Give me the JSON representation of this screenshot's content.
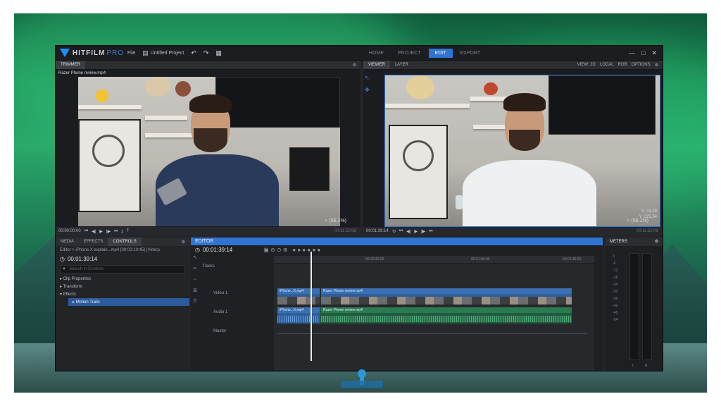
{
  "app": {
    "logo": "HITFILM",
    "logo_suffix": "PRO",
    "menu_file": "File",
    "project_name": "Untitled Project",
    "tabs": [
      "HOME",
      "PROJECT",
      "EDIT",
      "EXPORT"
    ],
    "active_tab": "EDIT"
  },
  "trimmer": {
    "tab": "TRIMMER",
    "clip_name": "Razer Phone review.mp4",
    "timecode": "00:00:00:00",
    "zoom": "(56.1%)",
    "end_timecode": "00:11:52:08"
  },
  "viewer": {
    "tabs": [
      "VIEWER",
      "LAYER"
    ],
    "view_mode": "VIEW: 2D",
    "local": "LOCAL",
    "rgb": "RGB",
    "options": "OPTIONS",
    "timecode": "00:01:39:14",
    "zoom": "(56.1%)",
    "coord_x": "X: 41.28",
    "coord_y": "Y: 225.54",
    "end_timecode": "00:11:52:08"
  },
  "controls": {
    "tabs": [
      "MEDIA",
      "EFFECTS",
      "CONTROLS"
    ],
    "editor_info": "Editor > iPhone X explain...mp4 [00:02:10:45] (Video)",
    "timecode": "00:01:39:14",
    "search_placeholder": "Search in Controls",
    "tree": [
      "Clip Properties",
      "Transform",
      "Effects"
    ],
    "selected_effect": "Motion Trails"
  },
  "editor": {
    "tab": "EDITOR",
    "timecode": "00:01:39:14",
    "tracks_label": "Tracks",
    "video_track": "Video 1",
    "audio_track": "Audio 1",
    "master": "Master",
    "clip_v1": "iPhone...X.mp4",
    "clip_v2": "Razer Phone review.mp4",
    "clip_a1": "iPhone...X.mp4",
    "clip_a2": "Razer Phone review.mp4",
    "ruler": [
      "00:00:30:00",
      "00:01:00:00",
      "00:01:30:00"
    ]
  },
  "meters": {
    "tab": "METERS",
    "scale": [
      "0",
      "-6",
      "-12",
      "-18",
      "-24",
      "-30",
      "-36",
      "-42",
      "-48",
      "-54"
    ],
    "channels": [
      "L",
      "R"
    ]
  }
}
